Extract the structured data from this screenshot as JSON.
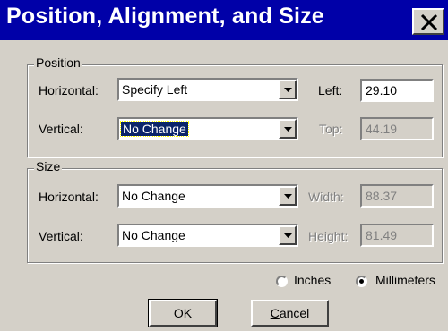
{
  "dialog": {
    "title": "Position, Alignment, and Size",
    "close_glyph": "X"
  },
  "position": {
    "legend": "Position",
    "horizontal_label": "Horizontal:",
    "horizontal_value": "Specify Left",
    "vertical_label": "Vertical:",
    "vertical_value": "No Change",
    "left_label": "Left:",
    "left_value": "29.10",
    "top_label": "Top:",
    "top_value": "44.19"
  },
  "size": {
    "legend": "Size",
    "horizontal_label": "Horizontal:",
    "horizontal_value": "No Change",
    "vertical_label": "Vertical:",
    "vertical_value": "No Change",
    "width_label": "Width:",
    "width_value": "88.37",
    "height_label": "Height:",
    "height_value": "81.49"
  },
  "units": {
    "inches_label": "Inches",
    "millimeters_label": "Millimeters",
    "selected": "Millimeters"
  },
  "buttons": {
    "ok_label": "OK",
    "cancel_first": "C",
    "cancel_rest": "ancel"
  }
}
